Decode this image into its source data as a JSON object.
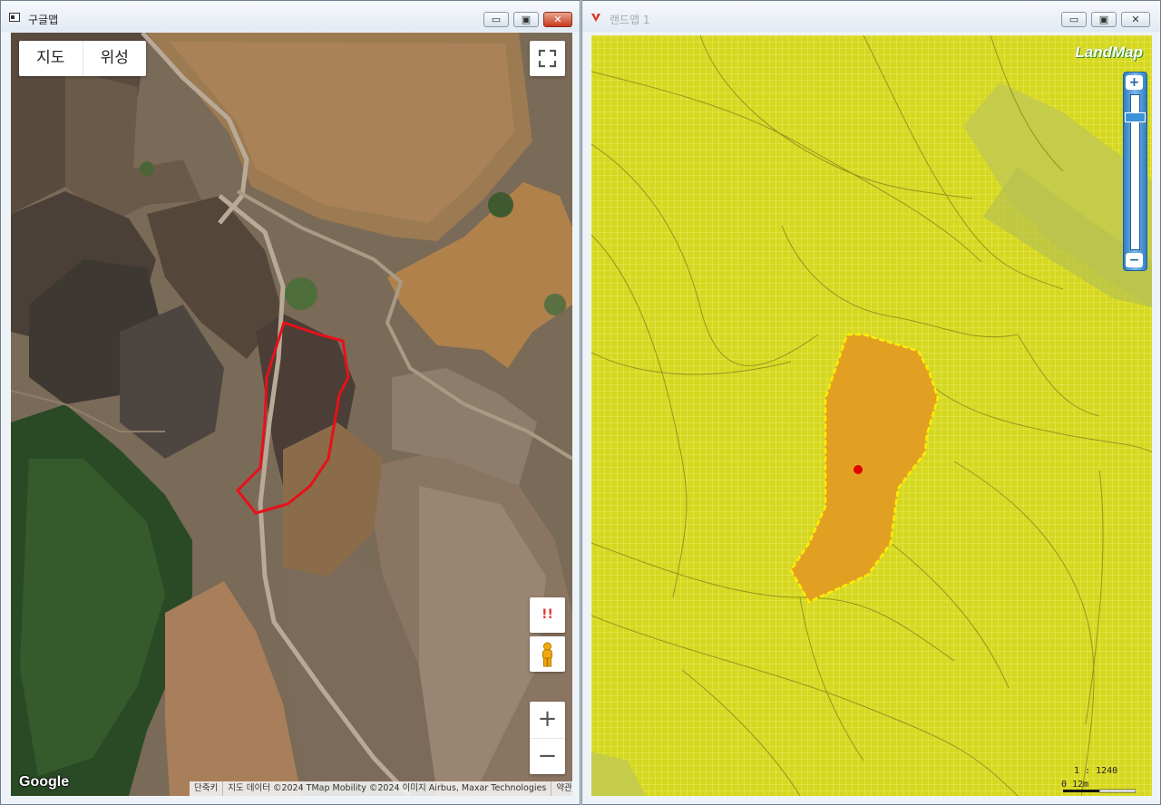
{
  "google_window": {
    "title": "구글맵",
    "controls": {
      "minimize": "▭",
      "maximize": "▣",
      "close": "✕"
    },
    "map_type": {
      "map_label": "지도",
      "satellite_label": "위성"
    },
    "report_label": "!!",
    "zoom_in_label": "+",
    "zoom_out_label": "−",
    "logo": "Google",
    "attribution": {
      "shortcuts": "단축키",
      "data": "지도 데이터 ©2024 TMap Mobility ©2024 이미지 Airbus, Maxar Technologies",
      "terms": "약관"
    }
  },
  "land_window": {
    "title": "랜드맵 1",
    "controls": {
      "minimize": "▭",
      "maximize": "▣",
      "close": "✕"
    },
    "logo": "LandMap",
    "zoom_in_label": "+",
    "zoom_out_label": "−",
    "scale_ratio": "1 : 1240",
    "scale_bar": "0   12m",
    "colors": {
      "background": "#dbdc25",
      "parcel": "#e2a023",
      "outline": "#ffee00",
      "marker": "#e00000"
    }
  }
}
